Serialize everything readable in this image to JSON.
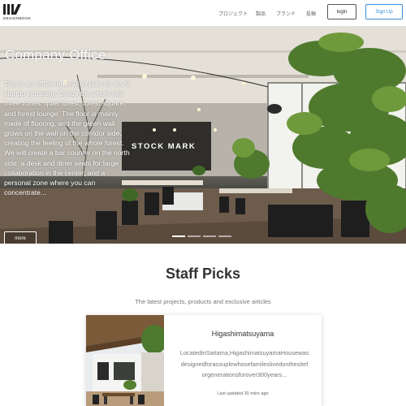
{
  "brand": {
    "logo_text": "DESIGNBOOK"
  },
  "nav": {
    "items": [
      "プロジェクト",
      "製品",
      "ブランド",
      "投稿"
    ],
    "login_label": "login",
    "signup_label": "Sign Up",
    "signup_color": "#3b8fd9"
  },
  "hero": {
    "title": "Company Office",
    "description": "This is an office renovation plan for an AI startup company. Divide the whole into three zones: quiet forest, forest square, and forest lounge. The floor is mainly made of flooring, and the green wall grows on the wall on the corridor side, creating the feeling of the whole forest. We will create a bar counter on the north side, a desk and diner seats for large collaboration in the center, and a personal zone where you can concentrate...",
    "more_label": "more",
    "sign_text": "STOCK MARK",
    "slides": 4,
    "active_slide": 0
  },
  "staff_picks": {
    "title": "Staff Picks",
    "subtitle": "The latest projects, products and exclusive articles",
    "card": {
      "title": "Higashimatsuyama",
      "description": "LocatedinSaitama,HigashimatsuyamaHousewasdesignedforacouplewhosefamileslivedonthesiteforgenerationsforover300years...",
      "updated": "Last updated 30 mins ago"
    }
  }
}
